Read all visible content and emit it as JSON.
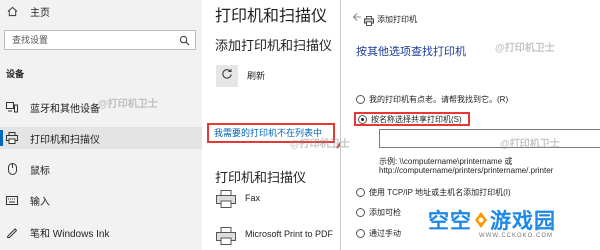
{
  "nav": {
    "home": "主页",
    "search_placeholder": "查找设置",
    "section": "设备",
    "items": [
      {
        "label": "蓝牙和其他设备",
        "icon": "bluetooth-devices-icon"
      },
      {
        "label": "打印机和扫描仪",
        "icon": "printer-icon"
      },
      {
        "label": "鼠标",
        "icon": "mouse-icon"
      },
      {
        "label": "输入",
        "icon": "keyboard-icon"
      },
      {
        "label": "笔和 Windows Ink",
        "icon": "pen-icon"
      }
    ],
    "selected_index": 1
  },
  "main": {
    "title": "打印机和扫描仪",
    "add_heading": "添加打印机和扫描仪",
    "refresh_label": "刷新",
    "not_listed_link": "我需要的打印机不在列表中",
    "printers_heading": "打印机和扫描仪",
    "printers": [
      {
        "name": "Fax"
      },
      {
        "name": "Microsoft Print to PDF"
      }
    ]
  },
  "dialog": {
    "window_title": "添加打印机",
    "heading": "按其他选项查找打印机",
    "options": [
      {
        "label": "我的打印机有点老。请帮我找到它。(R)",
        "selected": false
      },
      {
        "label": "按名称选择共享打印机(S)",
        "selected": true
      },
      {
        "label": "使用 TCP/IP 地址或主机名添加打印机(I)",
        "selected": false
      },
      {
        "label": "添加可检",
        "selected": false
      },
      {
        "label": "通过手动",
        "selected": false
      }
    ],
    "example_line1": "示例: \\\\computername\\printername 或",
    "example_line2": "http://computername/printers/printername/.printer",
    "share_input_value": ""
  },
  "watermarks": {
    "text": "@打印机卫士"
  },
  "logo": {
    "part1": "空空",
    "part2": "游戏园",
    "url": "WWW.CCKOKO.COM"
  },
  "colors": {
    "accent": "#0067c0",
    "link": "#0063b1",
    "highlight": "#e53935",
    "dialog_heading": "#1e3c96",
    "logo": "#1e88e5"
  }
}
